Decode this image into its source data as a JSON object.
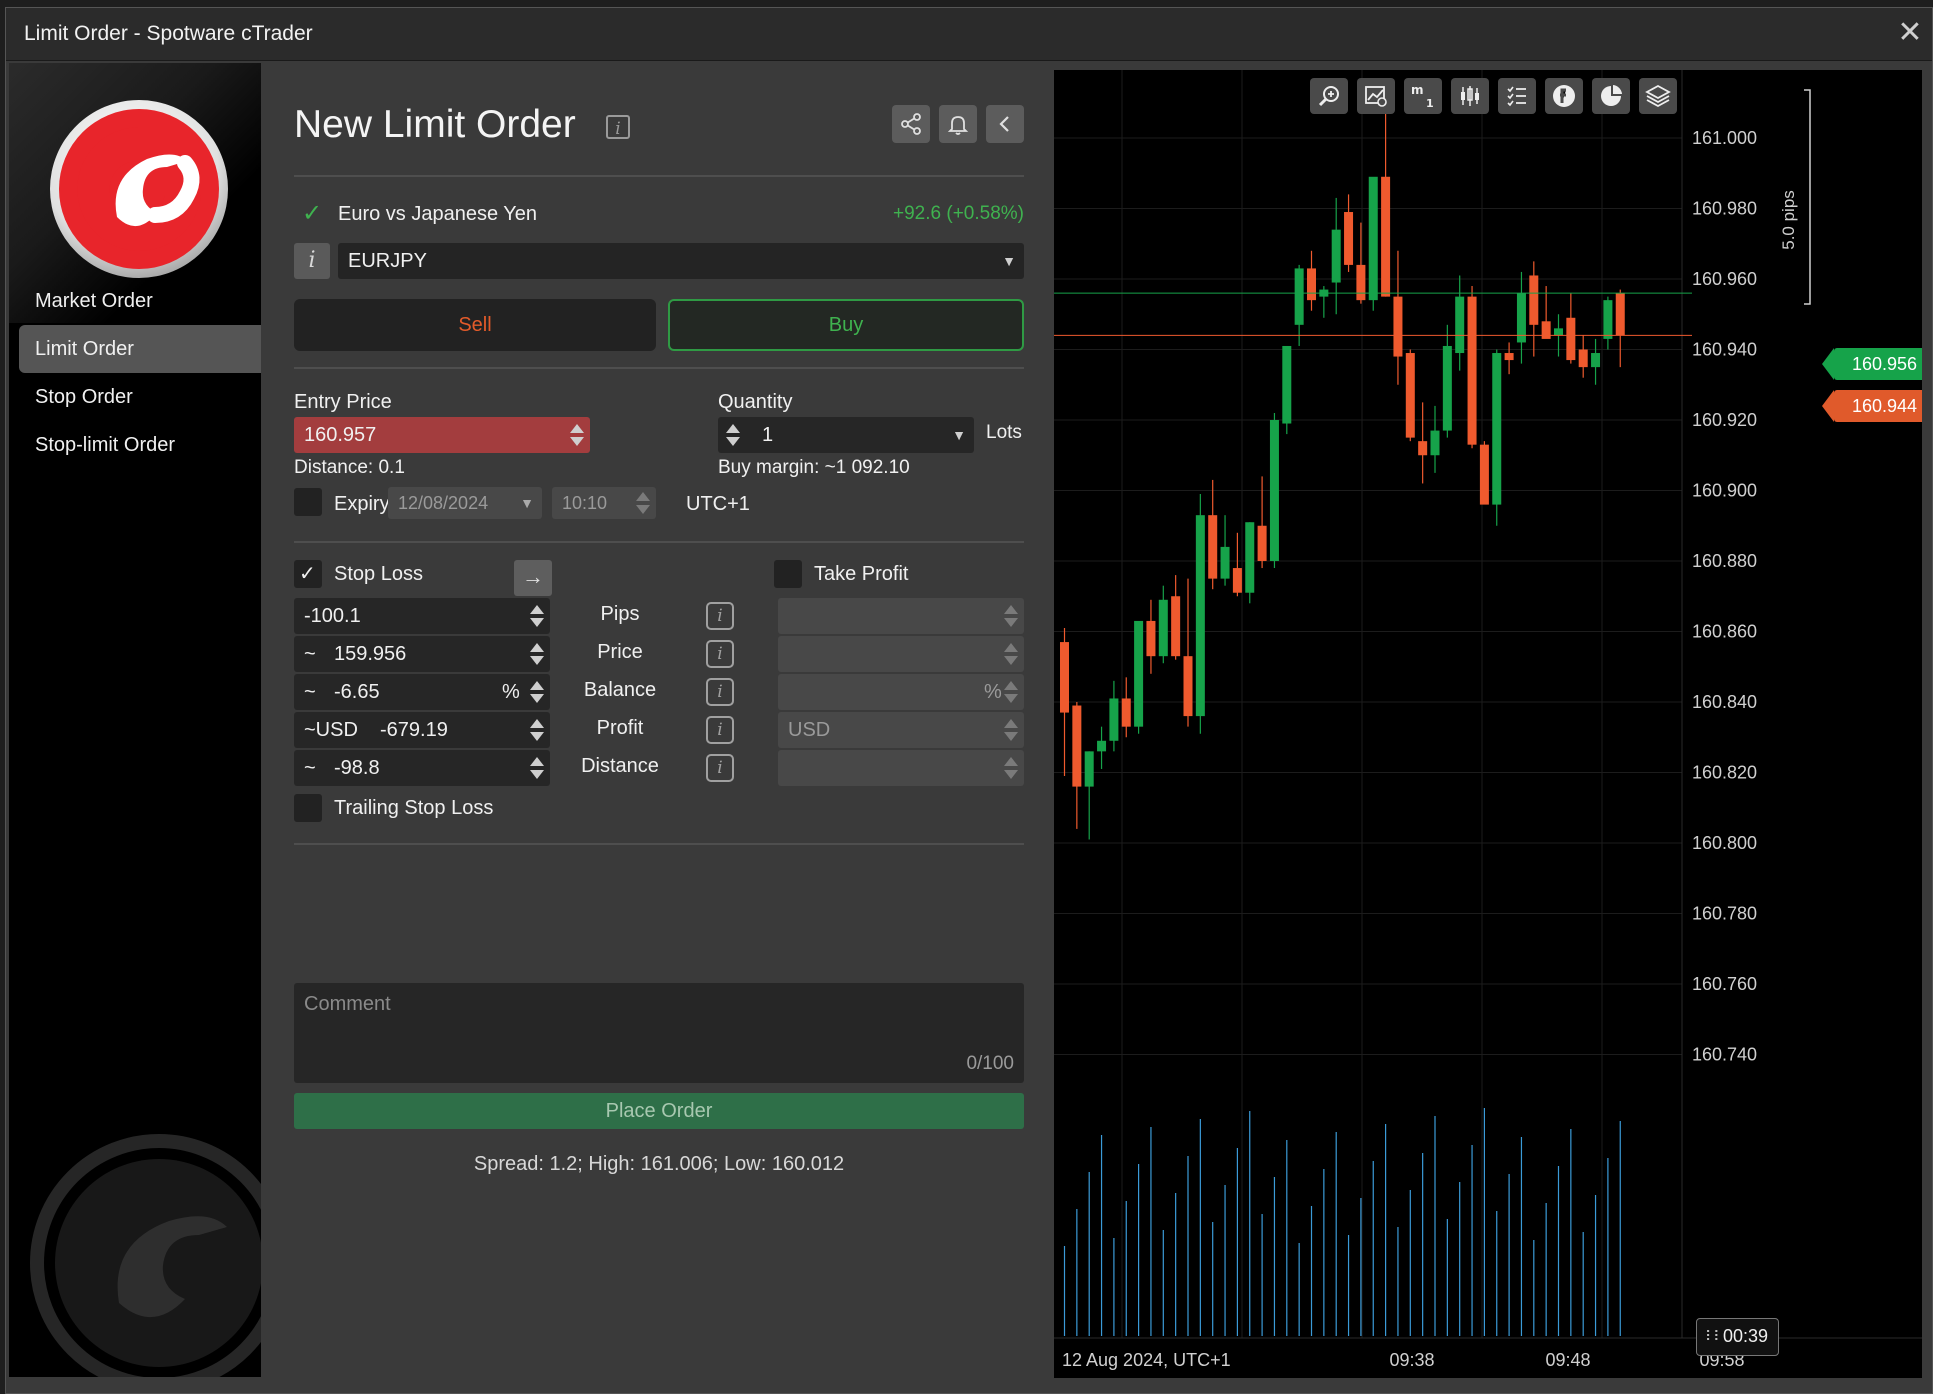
{
  "window": {
    "title": "Limit Order - Spotware cTrader"
  },
  "sidebar": {
    "items": [
      {
        "label": "Market Order",
        "active": false
      },
      {
        "label": "Limit Order",
        "active": true
      },
      {
        "label": "Stop Order",
        "active": false
      },
      {
        "label": "Stop-limit Order",
        "active": false
      }
    ]
  },
  "form": {
    "title": "New Limit Order",
    "instrument_name": "Euro vs Japanese Yen",
    "change": "+92.6 (+0.58%)",
    "symbol": "EURJPY",
    "sell_label": "Sell",
    "buy_label": "Buy",
    "entry_price_label": "Entry Price",
    "entry_price": "160.957",
    "quantity_label": "Quantity",
    "quantity": "1",
    "lots_label": "Lots",
    "distance": "Distance: 0.1",
    "buy_margin": "Buy margin: ~1 092.10",
    "expiry_label": "Expiry",
    "expiry_date": "12/08/2024",
    "expiry_time": "10:10",
    "timezone": "UTC+1",
    "stop_loss_label": "Stop Loss",
    "take_profit_label": "Take Profit",
    "sl": {
      "pips": "-100.1",
      "price_prefix": "~",
      "price": "159.956",
      "balance_prefix": "~",
      "balance": "-6.65",
      "balance_unit": "%",
      "profit_prefix": "~USD",
      "profit": "-679.19",
      "distance_prefix": "~",
      "distance": "-98.8"
    },
    "rows": {
      "pips": "Pips",
      "price": "Price",
      "balance": "Balance",
      "profit": "Profit",
      "distance": "Distance"
    },
    "tp": {
      "balance_unit": "%",
      "profit_unit": "USD"
    },
    "trailing_label": "Trailing Stop Loss",
    "comment_placeholder": "Comment",
    "comment_count": "0/100",
    "place_order_label": "Place Order",
    "spread_text": "Spread: 1.2; High: 161.006; Low: 160.012"
  },
  "chart": {
    "pips_label": "5.0 pips",
    "bid_tag": "160.956",
    "ask_tag": "160.944",
    "date_label": "12 Aug 2024, UTC+1",
    "time_labels": [
      "09:38",
      "09:48",
      "09:58"
    ],
    "timer": "00:39",
    "axis_labels": [
      "161.000",
      "160.980",
      "160.960",
      "160.940",
      "160.920",
      "160.900",
      "160.880",
      "160.860",
      "160.840",
      "160.820",
      "160.800",
      "160.780",
      "160.760",
      "160.740"
    ],
    "colors": {
      "up": "#16a34a",
      "down": "#ef5a2e",
      "volume": "#3b9bd8",
      "bid_line": "#16a34a",
      "ask_line": "#ef5a2e"
    }
  },
  "chart_data": {
    "type": "candlestick",
    "symbol": "EURJPY",
    "timeframe": "m1",
    "date": "12 Aug 2024, UTC+1",
    "y_axis_ticks": [
      161.0,
      160.98,
      160.96,
      160.94,
      160.92,
      160.9,
      160.88,
      160.86,
      160.84,
      160.82,
      160.8,
      160.78,
      160.76,
      160.74
    ],
    "candles": [
      {
        "o": 160.857,
        "h": 160.861,
        "l": 160.819,
        "c": 160.837
      },
      {
        "o": 160.839,
        "h": 160.84,
        "l": 160.804,
        "c": 160.816
      },
      {
        "o": 160.816,
        "h": 160.826,
        "l": 160.801,
        "c": 160.826
      },
      {
        "o": 160.826,
        "h": 160.833,
        "l": 160.821,
        "c": 160.829
      },
      {
        "o": 160.829,
        "h": 160.846,
        "l": 160.826,
        "c": 160.841
      },
      {
        "o": 160.841,
        "h": 160.847,
        "l": 160.83,
        "c": 160.833
      },
      {
        "o": 160.833,
        "h": 160.862,
        "l": 160.831,
        "c": 160.863
      },
      {
        "o": 160.863,
        "h": 160.869,
        "l": 160.848,
        "c": 160.853
      },
      {
        "o": 160.853,
        "h": 160.873,
        "l": 160.851,
        "c": 160.869
      },
      {
        "o": 160.87,
        "h": 160.876,
        "l": 160.852,
        "c": 160.853
      },
      {
        "o": 160.853,
        "h": 160.875,
        "l": 160.833,
        "c": 160.836
      },
      {
        "o": 160.836,
        "h": 160.899,
        "l": 160.831,
        "c": 160.893
      },
      {
        "o": 160.893,
        "h": 160.903,
        "l": 160.872,
        "c": 160.875
      },
      {
        "o": 160.875,
        "h": 160.893,
        "l": 160.873,
        "c": 160.884
      },
      {
        "o": 160.878,
        "h": 160.888,
        "l": 160.87,
        "c": 160.871
      },
      {
        "o": 160.871,
        "h": 160.891,
        "l": 160.868,
        "c": 160.891
      },
      {
        "o": 160.89,
        "h": 160.904,
        "l": 160.878,
        "c": 160.88
      },
      {
        "o": 160.88,
        "h": 160.922,
        "l": 160.878,
        "c": 160.92
      },
      {
        "o": 160.919,
        "h": 160.941,
        "l": 160.916,
        "c": 160.941
      },
      {
        "o": 160.947,
        "h": 160.964,
        "l": 160.941,
        "c": 160.963
      },
      {
        "o": 160.963,
        "h": 160.968,
        "l": 160.951,
        "c": 160.954
      },
      {
        "o": 160.955,
        "h": 160.958,
        "l": 160.949,
        "c": 160.957
      },
      {
        "o": 160.959,
        "h": 160.983,
        "l": 160.95,
        "c": 160.974
      },
      {
        "o": 160.979,
        "h": 160.984,
        "l": 160.962,
        "c": 160.964
      },
      {
        "o": 160.964,
        "h": 160.976,
        "l": 160.953,
        "c": 160.954
      },
      {
        "o": 160.954,
        "h": 160.984,
        "l": 160.951,
        "c": 160.989
      },
      {
        "o": 160.989,
        "h": 161.008,
        "l": 160.955,
        "c": 160.955
      },
      {
        "o": 160.955,
        "h": 160.968,
        "l": 160.93,
        "c": 160.938
      },
      {
        "o": 160.939,
        "h": 160.94,
        "l": 160.914,
        "c": 160.915
      },
      {
        "o": 160.914,
        "h": 160.925,
        "l": 160.902,
        "c": 160.91
      },
      {
        "o": 160.91,
        "h": 160.924,
        "l": 160.905,
        "c": 160.917
      },
      {
        "o": 160.917,
        "h": 160.947,
        "l": 160.915,
        "c": 160.941
      },
      {
        "o": 160.939,
        "h": 160.961,
        "l": 160.934,
        "c": 160.955
      },
      {
        "o": 160.955,
        "h": 160.958,
        "l": 160.912,
        "c": 160.913
      },
      {
        "o": 160.913,
        "h": 160.914,
        "l": 160.898,
        "c": 160.896
      },
      {
        "o": 160.896,
        "h": 160.94,
        "l": 160.89,
        "c": 160.939
      },
      {
        "o": 160.939,
        "h": 160.942,
        "l": 160.933,
        "c": 160.937
      },
      {
        "o": 160.942,
        "h": 160.962,
        "l": 160.936,
        "c": 160.956
      },
      {
        "o": 160.961,
        "h": 160.965,
        "l": 160.938,
        "c": 160.947
      },
      {
        "o": 160.948,
        "h": 160.958,
        "l": 160.945,
        "c": 160.943
      },
      {
        "o": 160.944,
        "h": 160.95,
        "l": 160.938,
        "c": 160.946
      },
      {
        "o": 160.949,
        "h": 160.956,
        "l": 160.936,
        "c": 160.937
      },
      {
        "o": 160.94,
        "h": 160.944,
        "l": 160.932,
        "c": 160.935
      },
      {
        "o": 160.935,
        "h": 160.943,
        "l": 160.93,
        "c": 160.939
      },
      {
        "o": 160.943,
        "h": 160.955,
        "l": 160.94,
        "c": 160.954
      },
      {
        "o": 160.956,
        "h": 160.957,
        "l": 160.935,
        "c": 160.944
      }
    ],
    "bid": 160.956,
    "ask": 160.944,
    "x_tick_labels": [
      "09:38",
      "09:48",
      "09:58"
    ]
  }
}
